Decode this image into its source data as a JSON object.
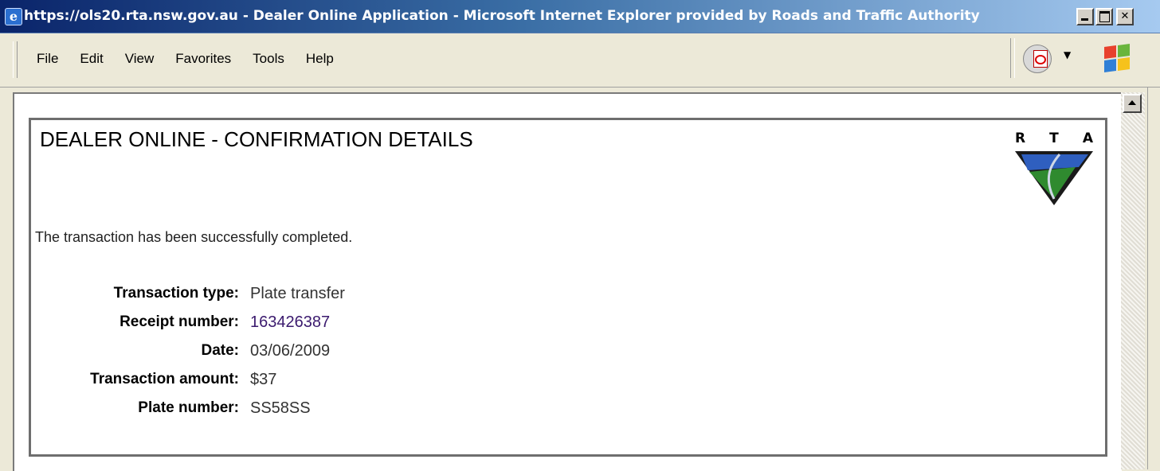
{
  "window": {
    "title": "https://ols20.rta.nsw.gov.au - Dealer Online Application - Microsoft Internet Explorer provided by Roads and Traffic Authority"
  },
  "menubar": {
    "items": [
      "File",
      "Edit",
      "View",
      "Favorites",
      "Tools",
      "Help"
    ]
  },
  "page": {
    "title": "DEALER ONLINE - CONFIRMATION DETAILS",
    "logo_text": [
      "R",
      "T",
      "A"
    ],
    "status_message": "The transaction has been successfully completed."
  },
  "details": [
    {
      "label": "Transaction type:",
      "value": "Plate transfer"
    },
    {
      "label": "Receipt number:",
      "value": "163426387"
    },
    {
      "label": "Date:",
      "value": "03/06/2009"
    },
    {
      "label": "Transaction amount:",
      "value": "$37"
    },
    {
      "label": "Plate number:",
      "value": "SS58SS"
    }
  ],
  "colors": {
    "title_bar": "#0a246a",
    "logo_blue": "#2f5fbf",
    "logo_green": "#2f8a2f"
  }
}
